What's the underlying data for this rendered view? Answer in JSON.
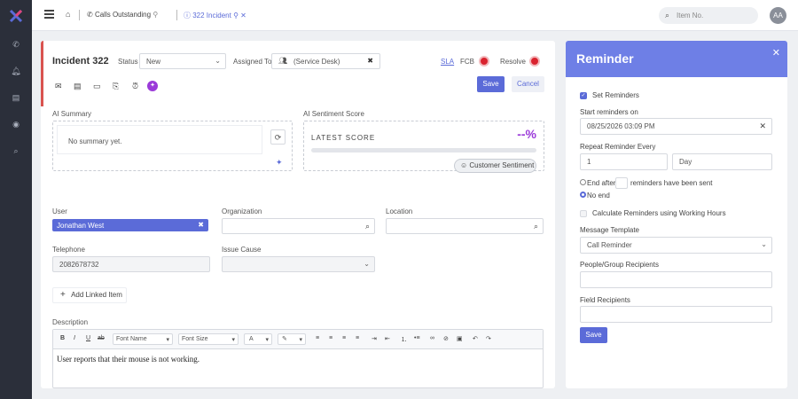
{
  "topbar": {
    "tab1_label": "Calls Outstanding",
    "tab2_label": "322 Incident",
    "search_placeholder": "Item No.",
    "avatar_initials": "AA"
  },
  "incident": {
    "title": "Incident 322",
    "status_label": "Status",
    "status_value": "New",
    "assigned_label": "Assigned To",
    "assigned_value": "(Service Desk)",
    "sla_label": "SLA",
    "fcb_label": "FCB",
    "resolve_label": "Resolve",
    "save_label": "Save",
    "cancel_label": "Cancel"
  },
  "ai": {
    "summary_label": "AI Summary",
    "summary_text": "No summary yet.",
    "sentiment_label": "AI Sentiment Score",
    "latest_score_label": "LATEST SCORE",
    "score_value": "--%",
    "customer_sentiment_label": "Customer Sentiment"
  },
  "fields": {
    "user_label": "User",
    "user_value": "Jonathan West",
    "organization_label": "Organization",
    "location_label": "Location",
    "telephone_label": "Telephone",
    "telephone_value": "2082678732",
    "issue_cause_label": "Issue Cause",
    "add_linked_label": "Add Linked Item",
    "description_label": "Description",
    "description_text": "User reports that their mouse is not working."
  },
  "editor": {
    "font_name": "Font Name",
    "font_size": "Font Size",
    "bold": "B",
    "italic": "I",
    "underline": "U",
    "color_a": "A"
  },
  "reminder": {
    "title": "Reminder",
    "set_reminders_label": "Set Reminders",
    "start_label": "Start reminders on",
    "start_value": "08/25/2026 03:09 PM",
    "repeat_label": "Repeat Reminder Every",
    "repeat_count": "1",
    "repeat_unit": "Day",
    "end_after_label": "End after",
    "end_after_suffix": "reminders have been sent",
    "no_end_label": "No end",
    "working_hours_label": "Calculate Reminders using Working Hours",
    "template_label": "Message Template",
    "template_value": "Call Reminder",
    "people_label": "People/Group Recipients",
    "field_recipients_label": "Field Recipients",
    "save_label": "Save"
  },
  "colors": {
    "accent": "#5b6bd8",
    "reminder_header": "#6e7fe6",
    "rail": "#2b2f3a",
    "status_red": "#d9232e"
  }
}
